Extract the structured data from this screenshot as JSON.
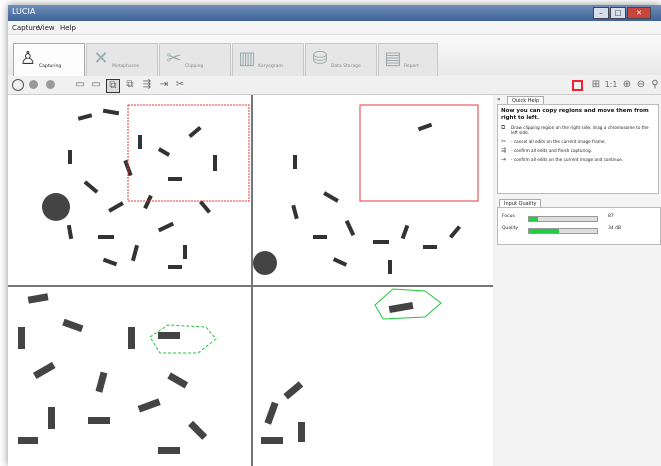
{
  "window": {
    "title": "LUCIA"
  },
  "menu": [
    "Capture",
    "View",
    "Help"
  ],
  "workflow_tabs": [
    {
      "label": "Capturing",
      "icon": "microscope-icon",
      "active": true
    },
    {
      "label": "Metaphases",
      "icon": "metaphases-icon",
      "active": false
    },
    {
      "label": "Clipping",
      "icon": "scissors-icon",
      "active": false
    },
    {
      "label": "Karyogram",
      "icon": "karyogram-icon",
      "active": false
    },
    {
      "label": "Data Storage",
      "icon": "database-icon",
      "active": false
    },
    {
      "label": "Report",
      "icon": "report-icon",
      "active": false
    }
  ],
  "toolbar_right": {
    "zoom_label": "1:1"
  },
  "panel": {
    "quick_help": {
      "tab_label": "Quick Help",
      "expander": "»",
      "heading": "Now you can copy regions and move them from right to left.",
      "lines": [
        "Draw clipping region on the right side; drag a chromosome to the left side.",
        "- cancel all edits on the current image frame.",
        "- confirm all edits and finish capturing.",
        "- confirm all edits on the current image and continue."
      ]
    },
    "input_quality": {
      "tab_label": "Input Quality",
      "rows": [
        {
          "label": "Focus",
          "value": "87",
          "level": 0.13,
          "color": "#22cc44"
        },
        {
          "label": "Quality",
          "value": "34 dB",
          "level": 0.44,
          "color": "#22cc44"
        }
      ]
    }
  },
  "colors": {
    "clip_region": "#e53b3b",
    "selection": "#22c43a"
  }
}
